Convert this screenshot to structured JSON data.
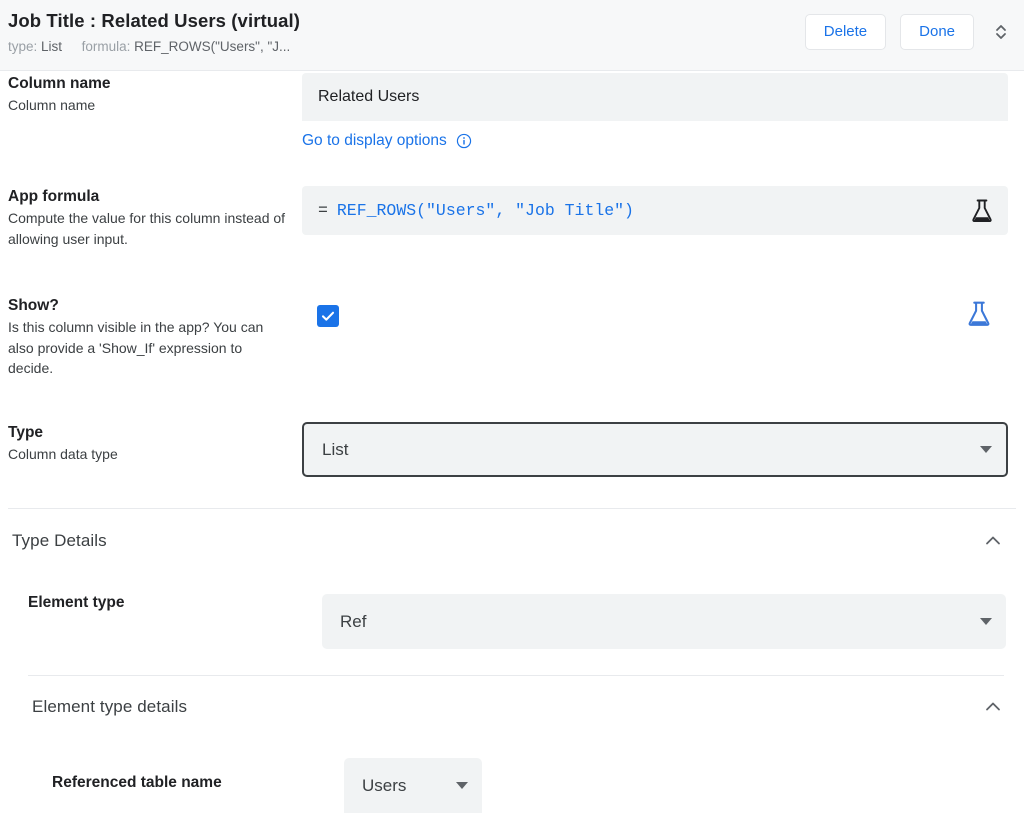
{
  "header": {
    "title": "Job Title : Related Users (virtual)",
    "type_label": "type:",
    "type_value": "List",
    "formula_label": "formula:",
    "formula_value": "REF_ROWS(\"Users\", \"J...",
    "delete_label": "Delete",
    "done_label": "Done",
    "stepper_icon": "expand-collapse-icon",
    "bg_color": "#f7f8f9",
    "link_color": "#1a73e8"
  },
  "column_name": {
    "label": "Column name",
    "description": "Column name",
    "value": "Related Users",
    "link_label": "Go to display options",
    "info_icon": "info-circle-icon"
  },
  "app_formula": {
    "label": "App formula",
    "description": "Compute the value for this column instead of allowing user input.",
    "equals": "=",
    "formula": "REF_ROWS(\"Users\", \"Job Title\")",
    "flask_icon": "flask-icon",
    "formula_color": "#1a73e8"
  },
  "show": {
    "label": "Show?",
    "description": "Is this column visible in the app? You can also provide a 'Show_If' expression to decide.",
    "checked": true,
    "checkbox_color": "#1a73e8",
    "flask_icon": "flask-icon",
    "flask_color": "#3c78d8"
  },
  "type": {
    "label": "Type",
    "description": "Column data type",
    "value": "List",
    "caret_icon": "caret-down-icon"
  },
  "type_details": {
    "title": "Type Details",
    "collapse_icon": "chevron-up-icon",
    "element_type": {
      "label": "Element type",
      "value": "Ref",
      "caret_icon": "caret-down-icon"
    }
  },
  "element_type_details": {
    "title": "Element type details",
    "collapse_icon": "chevron-up-icon",
    "referenced_table": {
      "label": "Referenced table name",
      "value": "Users",
      "caret_icon": "caret-down-icon"
    }
  }
}
